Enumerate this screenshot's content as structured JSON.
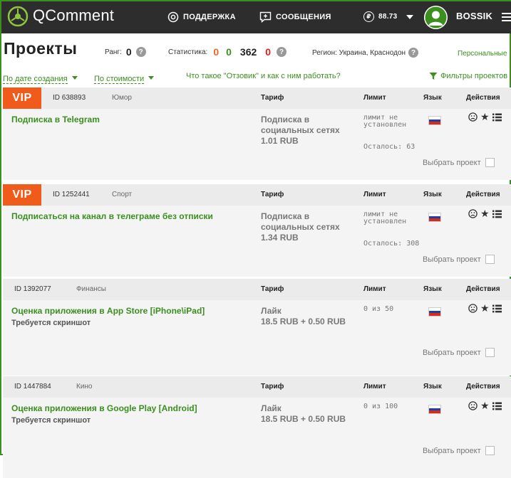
{
  "header": {
    "logo_text": "QComment",
    "support_label": "ПОДДЕРЖКА",
    "messages_label": "СООБЩЕНИЯ",
    "balance": "88.73",
    "username": "BOSSIK"
  },
  "page": {
    "title": "Проекты",
    "rank_label": "Ранг:",
    "rank_value": "0",
    "stats_label": "Статистика:",
    "stats": [
      "0",
      "0",
      "362",
      "0"
    ],
    "region_label": "Регион: Украина, Краснодон",
    "personal_link": "Персональные"
  },
  "filters": {
    "by_date": "По дате создания",
    "by_price": "По стоимости",
    "help_link": "Что такое \"Отзовик\" и как с ним работать?",
    "project_filters": "Фильтры проектов"
  },
  "columns": {
    "tariff": "Тариф",
    "limit": "Лимит",
    "language": "Язык",
    "actions": "Действия"
  },
  "vip_label": "VIP",
  "choose_label": "Выбрать проект",
  "projects": [
    {
      "id": "ID 638893",
      "category": "Юмор",
      "title": "Подписка в Telegram",
      "subtitle": "",
      "tariff_line1": "Подписка в",
      "tariff_line2": "социальных сетях",
      "price": "1.01 RUB",
      "limit_line1": "лимит не",
      "limit_line2": "установлен",
      "remaining": "Осталось: 63"
    },
    {
      "id": "ID 1252441",
      "category": "Спорт",
      "title": "Подписаться на канал в телеграме без отписки",
      "subtitle": "",
      "tariff_line1": "Подписка в",
      "tariff_line2": "социальных сетях",
      "price": "1.34 RUB",
      "limit_line1": "лимит не",
      "limit_line2": "установлен",
      "remaining": "Осталось: 308"
    },
    {
      "id": "ID 1392077",
      "category": "Финансы",
      "title": "Оценка приложения в App Store [iPhone\\iPad]",
      "subtitle": "Требуется скриншот",
      "tariff_line1": "Лайк",
      "tariff_line2": "",
      "price": "18.5 RUB + 0.50 RUB",
      "limit_line1": "0 из 50",
      "limit_line2": "",
      "remaining": ""
    },
    {
      "id": "ID 1447884",
      "category": "Кино",
      "title": "Оценка приложения в Google Play [Android]",
      "subtitle": "Требуется скриншот",
      "tariff_line1": "Лайк",
      "tariff_line2": "",
      "price": "18.5 RUB + 0.50 RUB",
      "limit_line1": "0 из 100",
      "limit_line2": "",
      "remaining": ""
    }
  ]
}
